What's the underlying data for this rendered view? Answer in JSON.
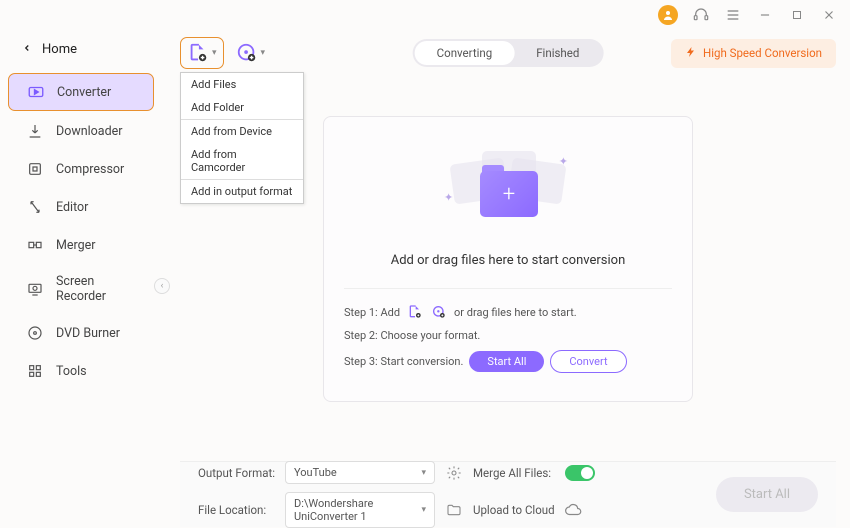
{
  "home_label": "Home",
  "sidebar": {
    "items": [
      {
        "label": "Converter"
      },
      {
        "label": "Downloader"
      },
      {
        "label": "Compressor"
      },
      {
        "label": "Editor"
      },
      {
        "label": "Merger"
      },
      {
        "label": "Screen Recorder"
      },
      {
        "label": "DVD Burner"
      },
      {
        "label": "Tools"
      }
    ]
  },
  "tabs": {
    "converting": "Converting",
    "finished": "Finished"
  },
  "hs_badge": "High Speed Conversion",
  "dropdown": {
    "add_files": "Add Files",
    "add_folder": "Add Folder",
    "add_device": "Add from Device",
    "add_camcorder": "Add from Camcorder",
    "add_output": "Add in output format"
  },
  "drop_text": "Add or drag files here to start conversion",
  "steps": {
    "s1a": "Step 1: Add",
    "s1b": "or drag files here to start.",
    "s2": "Step 2: Choose your format.",
    "s3": "Step 3: Start conversion.",
    "start_all": "Start All",
    "convert": "Convert"
  },
  "footer": {
    "output_format_label": "Output Format:",
    "output_format_value": "YouTube",
    "file_location_label": "File Location:",
    "file_location_value": "D:\\Wondershare UniConverter 1",
    "merge_label": "Merge All Files:",
    "upload_label": "Upload to Cloud",
    "start_all": "Start All"
  }
}
